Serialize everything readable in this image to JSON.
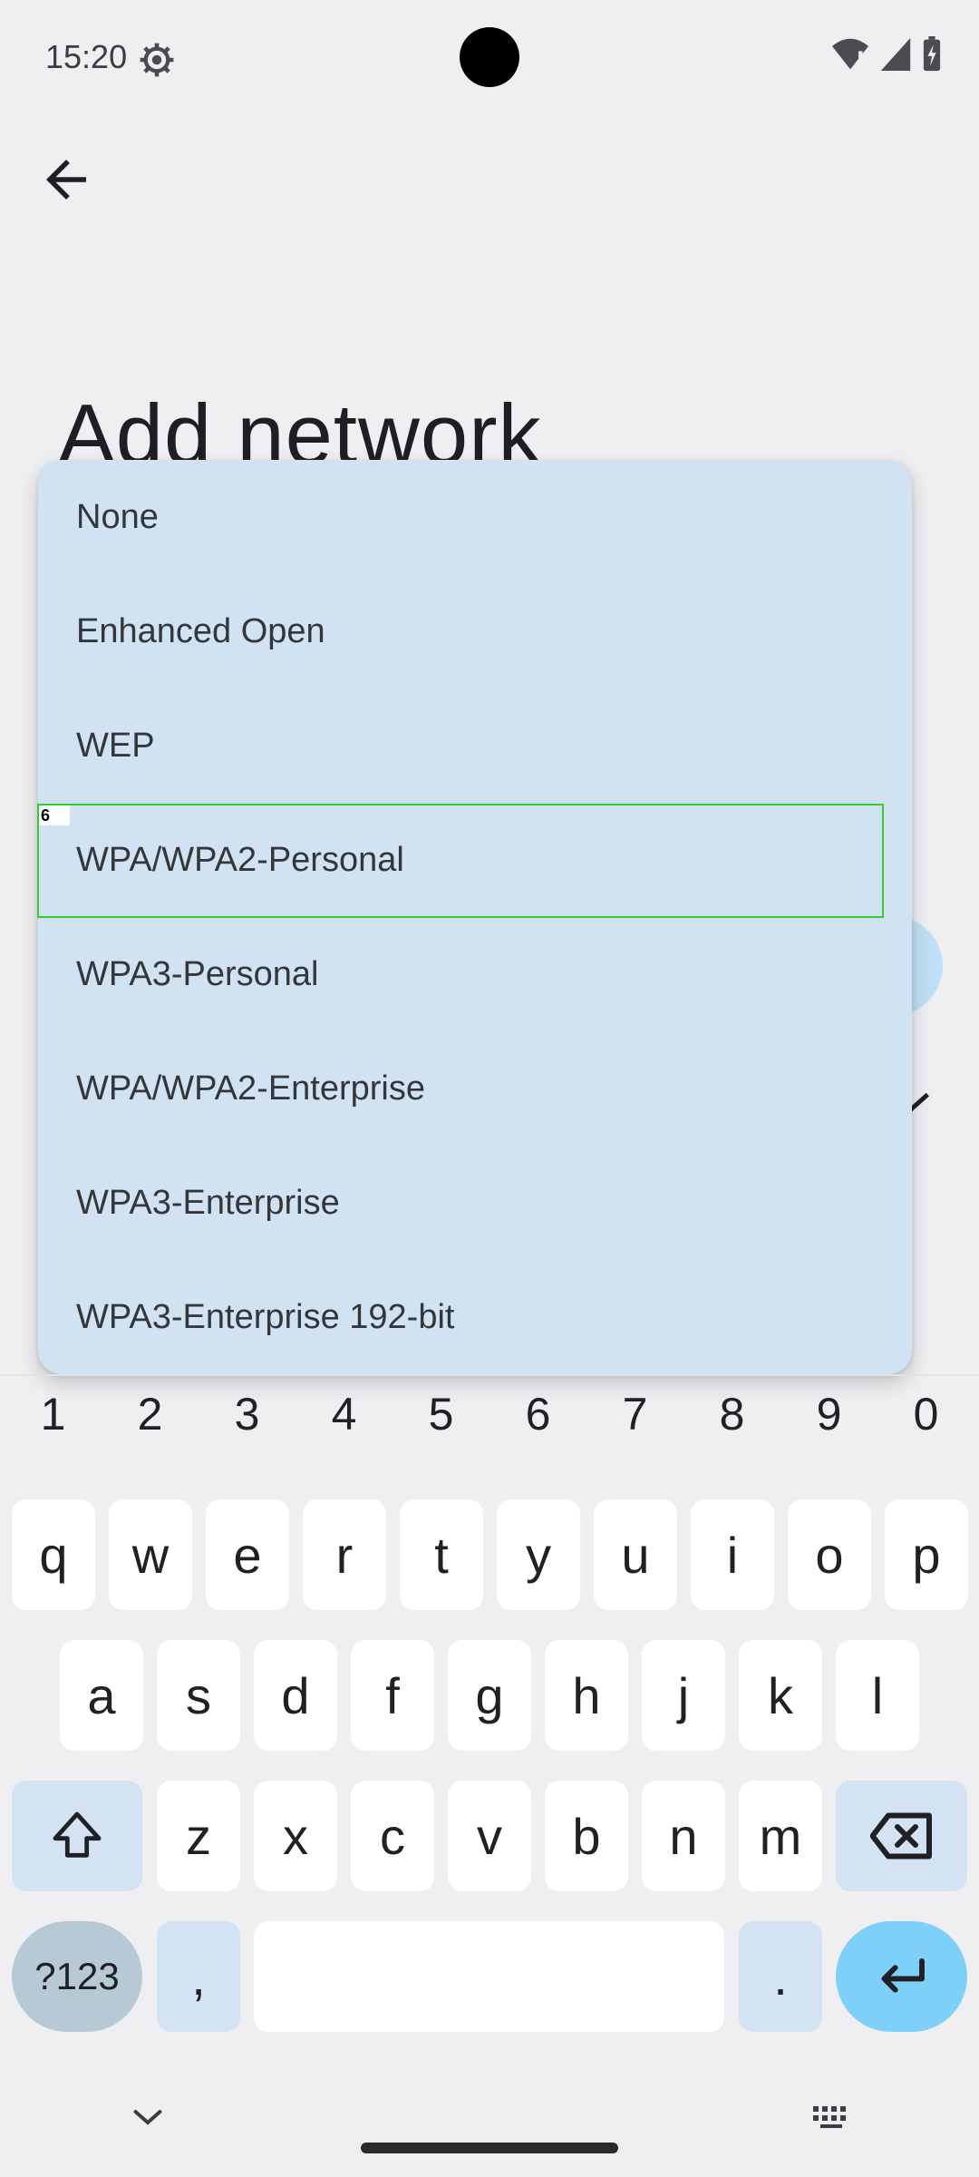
{
  "status_bar": {
    "time": "15:20"
  },
  "header": {
    "title": "Add network"
  },
  "security_menu": {
    "items": [
      "None",
      "Enhanced Open",
      "WEP",
      "WPA/WPA2-Personal",
      "WPA3-Personal",
      "WPA/WPA2-Enterprise",
      "WPA3-Enterprise",
      "WPA3-Enterprise 192-bit"
    ],
    "highlight_tag": "6"
  },
  "keyboard": {
    "numbers": [
      "1",
      "2",
      "3",
      "4",
      "5",
      "6",
      "7",
      "8",
      "9",
      "0"
    ],
    "row1": [
      "q",
      "w",
      "e",
      "r",
      "t",
      "y",
      "u",
      "i",
      "o",
      "p"
    ],
    "row2": [
      "a",
      "s",
      "d",
      "f",
      "g",
      "h",
      "j",
      "k",
      "l"
    ],
    "row3": [
      "z",
      "x",
      "c",
      "v",
      "b",
      "n",
      "m"
    ],
    "symbols_label": "?123",
    "comma": ",",
    "period": "."
  },
  "colors": {
    "menu_background": "#d1e3f2",
    "highlight": "#33cc33",
    "enter_key": "#7fd0f9"
  }
}
